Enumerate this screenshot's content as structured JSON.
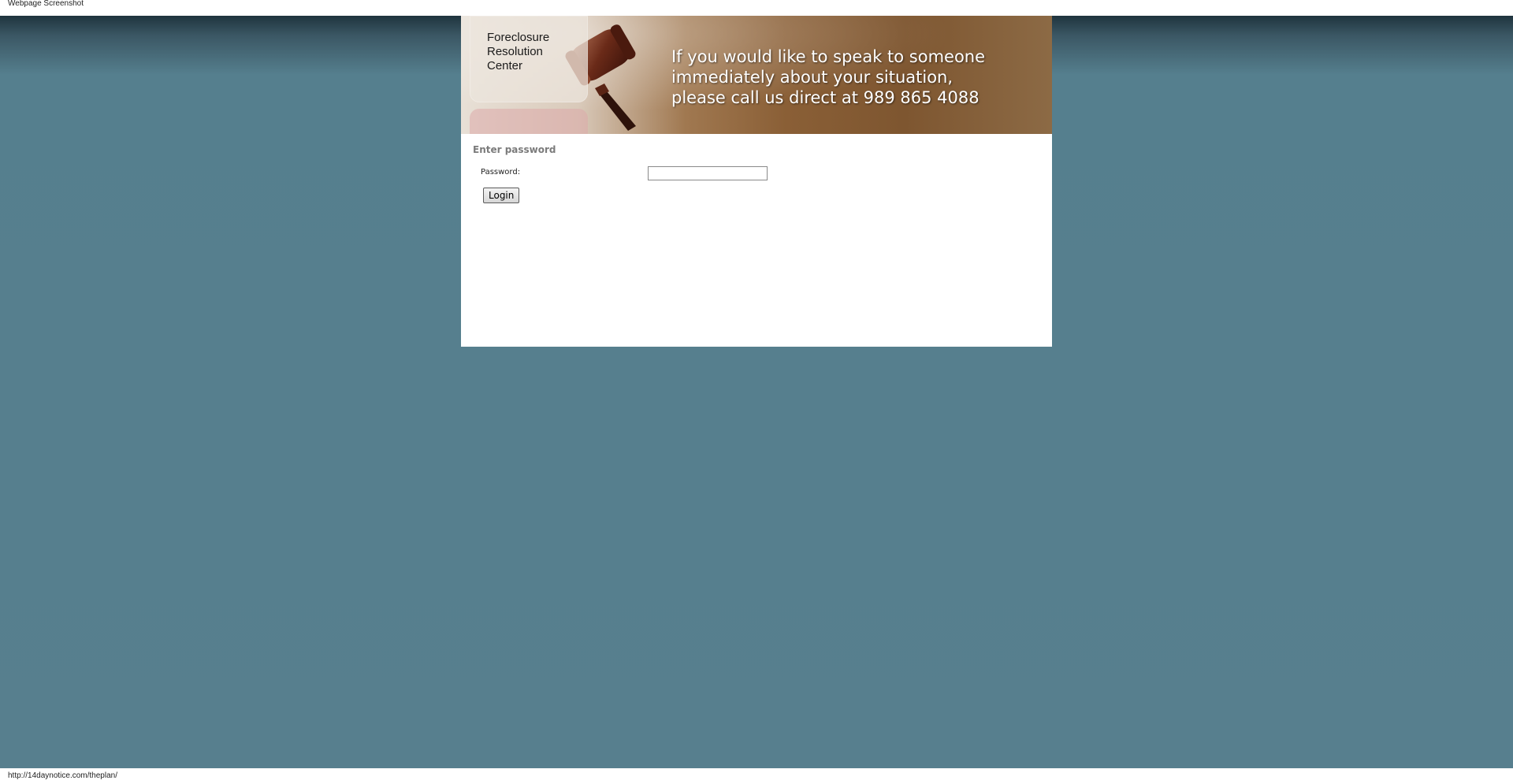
{
  "window": {
    "title": "Webpage Screenshot"
  },
  "header": {
    "logo_lines": [
      "Foreclosure",
      "Resolution",
      "Center"
    ],
    "message_lines": [
      "If you would like to speak to someone",
      "immediately about your situation,",
      "please call us direct at 989 865 4088"
    ]
  },
  "login": {
    "section_title": "Enter password",
    "password_label": "Password:",
    "password_value": "",
    "button_label": "Login"
  },
  "status_bar": {
    "url": "http://14daynotice.com/theplan/"
  },
  "colors": {
    "page_background": "#577f8e",
    "header_brown": "#8a5f36",
    "section_title": "#7b7b7b"
  }
}
